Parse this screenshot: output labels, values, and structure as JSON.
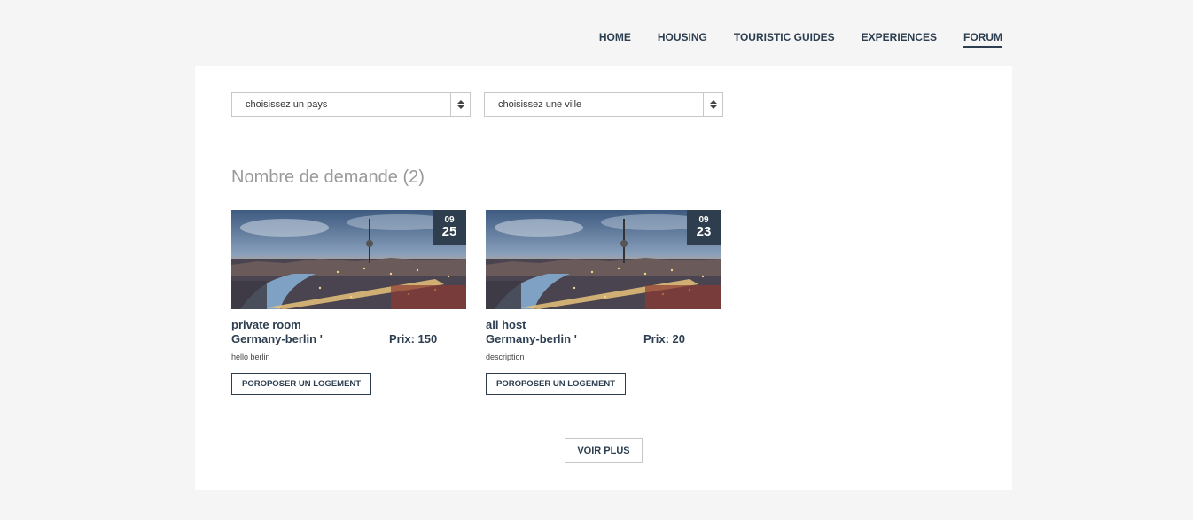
{
  "nav": {
    "items": [
      {
        "label": "HOME",
        "active": false
      },
      {
        "label": "HOUSING",
        "active": false
      },
      {
        "label": "TOURISTIC GUIDES",
        "active": false
      },
      {
        "label": "EXPERIENCES",
        "active": false
      },
      {
        "label": "FORUM",
        "active": true
      }
    ]
  },
  "filters": {
    "country": "choisissez un pays",
    "city": "choisissez une ville"
  },
  "heading": "Nombre de demande (2)",
  "cards": [
    {
      "month": "09",
      "day": "25",
      "title": "private room",
      "location": "Germany-berlin '",
      "price": "Prix: 150",
      "description": "hello berlin",
      "button": "POROPOSER UN LOGEMENT"
    },
    {
      "month": "09",
      "day": "23",
      "title": "all host",
      "location": "Germany-berlin '",
      "price": "Prix: 20",
      "description": "description",
      "button": "POROPOSER UN LOGEMENT"
    }
  ],
  "more_button": "VOIR PLUS",
  "colors": {
    "primary": "#2c3e50",
    "date_badge": "#2f3e4e",
    "page_bg": "#f5f5f5"
  }
}
